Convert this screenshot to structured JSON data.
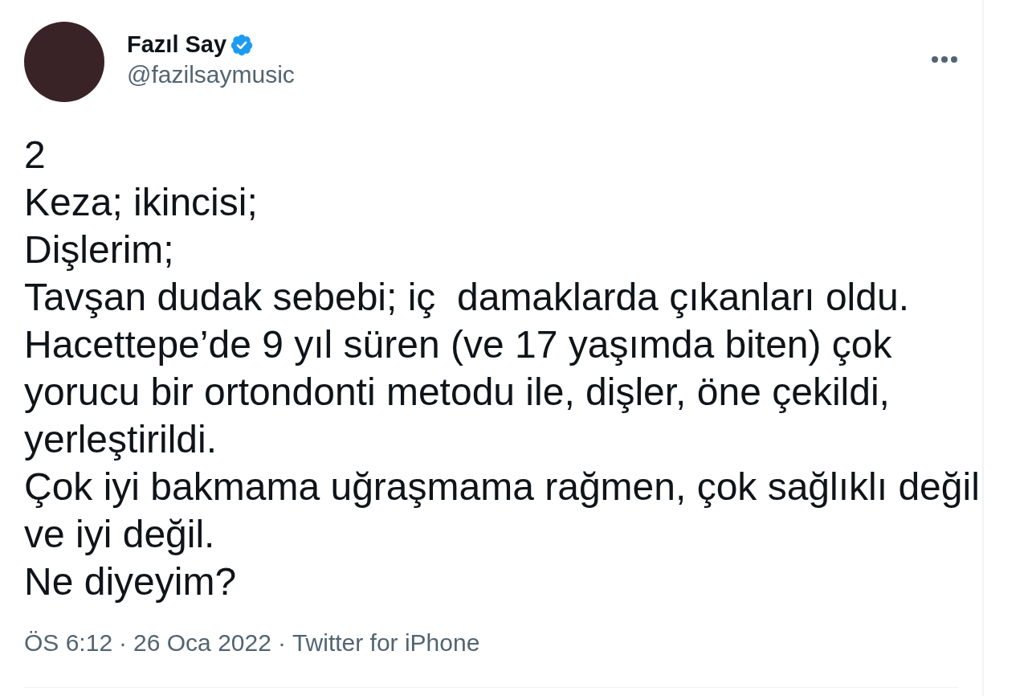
{
  "author": {
    "name": "Fazıl Say",
    "verified": true,
    "handle": "@fazilsaymusic"
  },
  "tweet_lines": [
    "2",
    "Keza; ikincisi;",
    "Dişlerim;",
    "Tavşan dudak sebebi; iç  damaklarda çıkanları oldu.",
    "Hacettepe’de 9 yıl süren (ve 17 yaşımda biten) çok yorucu bir ortondonti metodu ile, dişler, öne çekildi, yerleştirildi.",
    "Çok iyi bakmama uğraşmama rağmen, çok sağlıklı değil ve iyi değil.",
    "Ne diyeyim?"
  ],
  "meta": {
    "time": "ÖS 6:12",
    "separator_1": "·",
    "date": "26 Oca 2022",
    "separator_2": "·",
    "source": "Twitter for iPhone"
  }
}
